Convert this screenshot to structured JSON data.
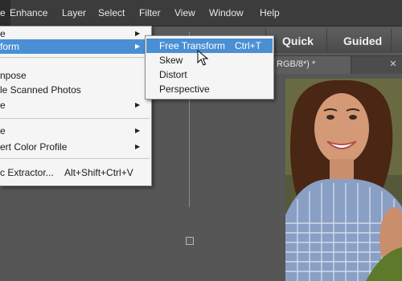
{
  "menubar": {
    "items": [
      "e",
      "Enhance",
      "Layer",
      "Select",
      "Filter",
      "View",
      "Window",
      "Help"
    ]
  },
  "modes": {
    "quick": "Quick",
    "guided": "Guided"
  },
  "document": {
    "tab_title": "RGB/8*) *"
  },
  "main_menu": {
    "items": [
      {
        "label": "e",
        "submenu": true
      },
      {
        "label": "form",
        "submenu": true
      },
      {
        "label": "npose"
      },
      {
        "label": "le Scanned Photos"
      },
      {
        "label": "e",
        "submenu": true
      },
      {
        "label": "e",
        "submenu": true
      },
      {
        "label": "ert Color Profile",
        "submenu": true
      },
      {
        "label": "c Extractor...",
        "shortcut": "Alt+Shift+Ctrl+V"
      }
    ]
  },
  "transform_submenu": {
    "items": [
      {
        "label": "Free Transform",
        "shortcut": "Ctrl+T"
      },
      {
        "label": "Skew"
      },
      {
        "label": "Distort"
      },
      {
        "label": "Perspective"
      }
    ]
  },
  "icons": {
    "submenu_arrow": "chevron-right-icon",
    "cursor": "arrow-cursor-icon",
    "close": "close-icon"
  },
  "colors": {
    "highlight": "#4a8fd4",
    "menubar": "#3c3c3c",
    "canvas": "#565656"
  }
}
